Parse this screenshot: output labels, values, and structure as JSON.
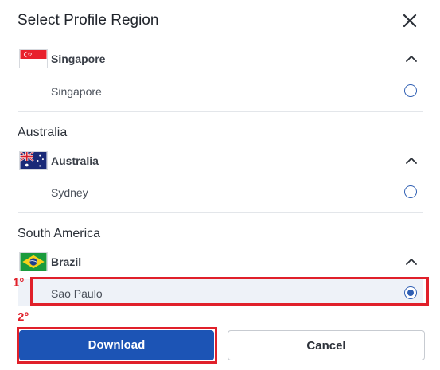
{
  "dialog": {
    "title": "Select Profile Region"
  },
  "groups": [
    {
      "label": "",
      "country": "Singapore",
      "flag_icon": "singapore-flag-icon",
      "regions": [
        {
          "name": "Singapore",
          "selected": false
        }
      ]
    },
    {
      "label": "Australia",
      "country": "Australia",
      "flag_icon": "australia-flag-icon",
      "regions": [
        {
          "name": "Sydney",
          "selected": false
        }
      ]
    },
    {
      "label": "South America",
      "country": "Brazil",
      "flag_icon": "brazil-flag-icon",
      "regions": [
        {
          "name": "Sao Paulo",
          "selected": true
        }
      ]
    }
  ],
  "callouts": {
    "step1": "1°",
    "step2": "2°"
  },
  "footer": {
    "download_label": "Download",
    "cancel_label": "Cancel"
  },
  "colors": {
    "primary": "#1c54b5",
    "callout": "#e0202a",
    "radio": "#2f5fb3"
  }
}
